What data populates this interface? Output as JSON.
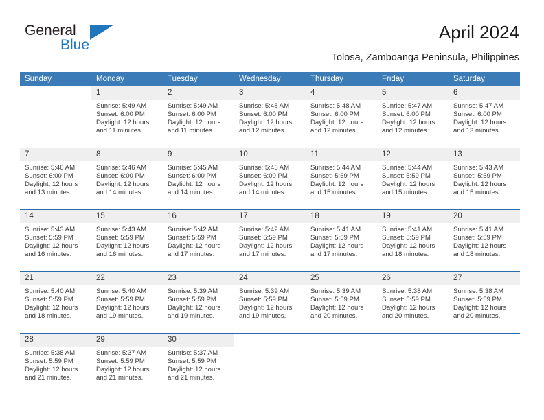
{
  "brand": {
    "name_part1": "General",
    "name_part2": "Blue",
    "primary_color": "#1f77bd",
    "header_color": "#3b7cb8",
    "rule_color": "#2b6cac",
    "numband_color": "#efefef"
  },
  "header": {
    "title": "April 2024",
    "subtitle": "Tolosa, Zamboanga Peninsula, Philippines"
  },
  "weekdays": [
    "Sunday",
    "Monday",
    "Tuesday",
    "Wednesday",
    "Thursday",
    "Friday",
    "Saturday"
  ],
  "weeks": [
    [
      {
        "num": "",
        "sunrise": "",
        "sunset": "",
        "daylight1": "",
        "daylight2": ""
      },
      {
        "num": "1",
        "sunrise": "Sunrise: 5:49 AM",
        "sunset": "Sunset: 6:00 PM",
        "daylight1": "Daylight: 12 hours",
        "daylight2": "and 11 minutes."
      },
      {
        "num": "2",
        "sunrise": "Sunrise: 5:49 AM",
        "sunset": "Sunset: 6:00 PM",
        "daylight1": "Daylight: 12 hours",
        "daylight2": "and 11 minutes."
      },
      {
        "num": "3",
        "sunrise": "Sunrise: 5:48 AM",
        "sunset": "Sunset: 6:00 PM",
        "daylight1": "Daylight: 12 hours",
        "daylight2": "and 12 minutes."
      },
      {
        "num": "4",
        "sunrise": "Sunrise: 5:48 AM",
        "sunset": "Sunset: 6:00 PM",
        "daylight1": "Daylight: 12 hours",
        "daylight2": "and 12 minutes."
      },
      {
        "num": "5",
        "sunrise": "Sunrise: 5:47 AM",
        "sunset": "Sunset: 6:00 PM",
        "daylight1": "Daylight: 12 hours",
        "daylight2": "and 12 minutes."
      },
      {
        "num": "6",
        "sunrise": "Sunrise: 5:47 AM",
        "sunset": "Sunset: 6:00 PM",
        "daylight1": "Daylight: 12 hours",
        "daylight2": "and 13 minutes."
      }
    ],
    [
      {
        "num": "7",
        "sunrise": "Sunrise: 5:46 AM",
        "sunset": "Sunset: 6:00 PM",
        "daylight1": "Daylight: 12 hours",
        "daylight2": "and 13 minutes."
      },
      {
        "num": "8",
        "sunrise": "Sunrise: 5:46 AM",
        "sunset": "Sunset: 6:00 PM",
        "daylight1": "Daylight: 12 hours",
        "daylight2": "and 14 minutes."
      },
      {
        "num": "9",
        "sunrise": "Sunrise: 5:45 AM",
        "sunset": "Sunset: 6:00 PM",
        "daylight1": "Daylight: 12 hours",
        "daylight2": "and 14 minutes."
      },
      {
        "num": "10",
        "sunrise": "Sunrise: 5:45 AM",
        "sunset": "Sunset: 6:00 PM",
        "daylight1": "Daylight: 12 hours",
        "daylight2": "and 14 minutes."
      },
      {
        "num": "11",
        "sunrise": "Sunrise: 5:44 AM",
        "sunset": "Sunset: 5:59 PM",
        "daylight1": "Daylight: 12 hours",
        "daylight2": "and 15 minutes."
      },
      {
        "num": "12",
        "sunrise": "Sunrise: 5:44 AM",
        "sunset": "Sunset: 5:59 PM",
        "daylight1": "Daylight: 12 hours",
        "daylight2": "and 15 minutes."
      },
      {
        "num": "13",
        "sunrise": "Sunrise: 5:43 AM",
        "sunset": "Sunset: 5:59 PM",
        "daylight1": "Daylight: 12 hours",
        "daylight2": "and 15 minutes."
      }
    ],
    [
      {
        "num": "14",
        "sunrise": "Sunrise: 5:43 AM",
        "sunset": "Sunset: 5:59 PM",
        "daylight1": "Daylight: 12 hours",
        "daylight2": "and 16 minutes."
      },
      {
        "num": "15",
        "sunrise": "Sunrise: 5:43 AM",
        "sunset": "Sunset: 5:59 PM",
        "daylight1": "Daylight: 12 hours",
        "daylight2": "and 16 minutes."
      },
      {
        "num": "16",
        "sunrise": "Sunrise: 5:42 AM",
        "sunset": "Sunset: 5:59 PM",
        "daylight1": "Daylight: 12 hours",
        "daylight2": "and 17 minutes."
      },
      {
        "num": "17",
        "sunrise": "Sunrise: 5:42 AM",
        "sunset": "Sunset: 5:59 PM",
        "daylight1": "Daylight: 12 hours",
        "daylight2": "and 17 minutes."
      },
      {
        "num": "18",
        "sunrise": "Sunrise: 5:41 AM",
        "sunset": "Sunset: 5:59 PM",
        "daylight1": "Daylight: 12 hours",
        "daylight2": "and 17 minutes."
      },
      {
        "num": "19",
        "sunrise": "Sunrise: 5:41 AM",
        "sunset": "Sunset: 5:59 PM",
        "daylight1": "Daylight: 12 hours",
        "daylight2": "and 18 minutes."
      },
      {
        "num": "20",
        "sunrise": "Sunrise: 5:41 AM",
        "sunset": "Sunset: 5:59 PM",
        "daylight1": "Daylight: 12 hours",
        "daylight2": "and 18 minutes."
      }
    ],
    [
      {
        "num": "21",
        "sunrise": "Sunrise: 5:40 AM",
        "sunset": "Sunset: 5:59 PM",
        "daylight1": "Daylight: 12 hours",
        "daylight2": "and 18 minutes."
      },
      {
        "num": "22",
        "sunrise": "Sunrise: 5:40 AM",
        "sunset": "Sunset: 5:59 PM",
        "daylight1": "Daylight: 12 hours",
        "daylight2": "and 19 minutes."
      },
      {
        "num": "23",
        "sunrise": "Sunrise: 5:39 AM",
        "sunset": "Sunset: 5:59 PM",
        "daylight1": "Daylight: 12 hours",
        "daylight2": "and 19 minutes."
      },
      {
        "num": "24",
        "sunrise": "Sunrise: 5:39 AM",
        "sunset": "Sunset: 5:59 PM",
        "daylight1": "Daylight: 12 hours",
        "daylight2": "and 19 minutes."
      },
      {
        "num": "25",
        "sunrise": "Sunrise: 5:39 AM",
        "sunset": "Sunset: 5:59 PM",
        "daylight1": "Daylight: 12 hours",
        "daylight2": "and 20 minutes."
      },
      {
        "num": "26",
        "sunrise": "Sunrise: 5:38 AM",
        "sunset": "Sunset: 5:59 PM",
        "daylight1": "Daylight: 12 hours",
        "daylight2": "and 20 minutes."
      },
      {
        "num": "27",
        "sunrise": "Sunrise: 5:38 AM",
        "sunset": "Sunset: 5:59 PM",
        "daylight1": "Daylight: 12 hours",
        "daylight2": "and 20 minutes."
      }
    ],
    [
      {
        "num": "28",
        "sunrise": "Sunrise: 5:38 AM",
        "sunset": "Sunset: 5:59 PM",
        "daylight1": "Daylight: 12 hours",
        "daylight2": "and 21 minutes."
      },
      {
        "num": "29",
        "sunrise": "Sunrise: 5:37 AM",
        "sunset": "Sunset: 5:59 PM",
        "daylight1": "Daylight: 12 hours",
        "daylight2": "and 21 minutes."
      },
      {
        "num": "30",
        "sunrise": "Sunrise: 5:37 AM",
        "sunset": "Sunset: 5:59 PM",
        "daylight1": "Daylight: 12 hours",
        "daylight2": "and 21 minutes."
      },
      {
        "num": "",
        "sunrise": "",
        "sunset": "",
        "daylight1": "",
        "daylight2": ""
      },
      {
        "num": "",
        "sunrise": "",
        "sunset": "",
        "daylight1": "",
        "daylight2": ""
      },
      {
        "num": "",
        "sunrise": "",
        "sunset": "",
        "daylight1": "",
        "daylight2": ""
      },
      {
        "num": "",
        "sunrise": "",
        "sunset": "",
        "daylight1": "",
        "daylight2": ""
      }
    ]
  ]
}
